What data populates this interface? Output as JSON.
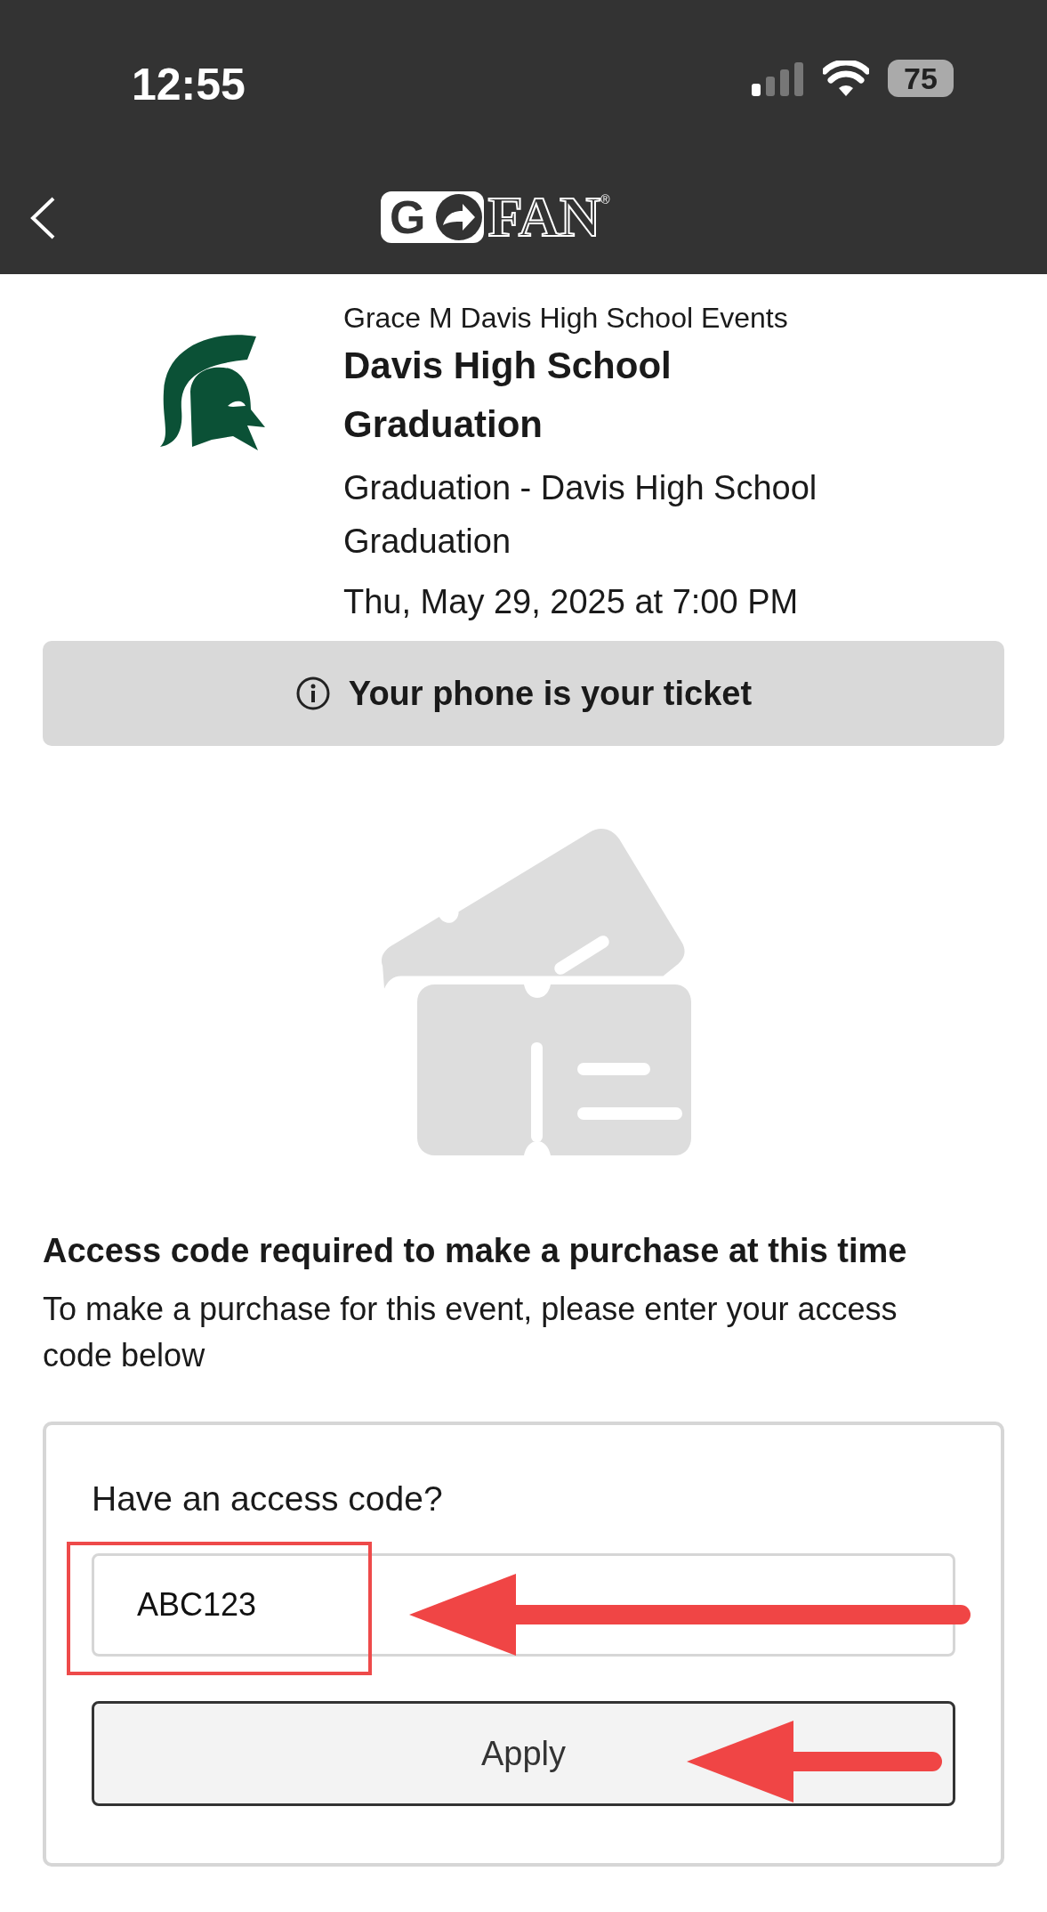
{
  "status_bar": {
    "time": "12:55",
    "battery": "75"
  },
  "nav": {
    "logo": {
      "left": "G",
      "right": "FAN",
      "mark": "®"
    }
  },
  "event": {
    "organizer": "Grace M Davis High School Events",
    "title": "Davis High School Graduation",
    "subtitle": "Graduation - Davis High School Graduation",
    "date": "Thu, May 29, 2025 at 7:00 PM"
  },
  "notice": "Your phone is your ticket",
  "access": {
    "heading": "Access code required to make a purchase at this time",
    "text": "To make a purchase for this event, please enter your access code below",
    "card": {
      "label": "Have an access code?",
      "value": "ABC123",
      "button": "Apply"
    }
  }
}
